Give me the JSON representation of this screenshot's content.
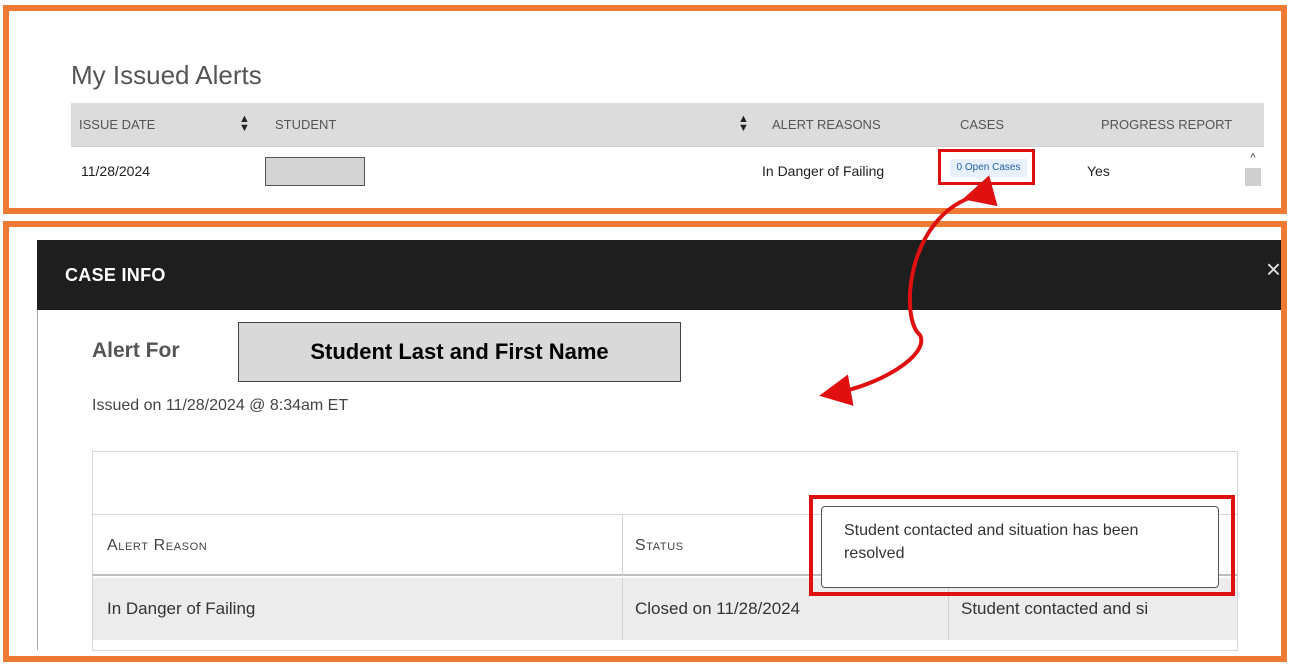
{
  "alerts": {
    "title": "My Issued Alerts",
    "columns": [
      "ISSUE DATE",
      "STUDENT",
      "ALERT REASONS",
      "CASES",
      "PROGRESS REPORT"
    ],
    "row": {
      "issue_date": "11/28/2024",
      "alert_reason": "In Danger of Failing",
      "cases_link": "0 Open Cases",
      "progress_report": "Yes"
    }
  },
  "modal": {
    "title": "CASE INFO",
    "close_icon": "×",
    "alert_for_label": "Alert For",
    "student_name": "Student Last and First Name",
    "issued_on": "Issued on 11/28/2024 @ 8:34am ET",
    "table": {
      "col_alert_reason": "Alert Reason",
      "col_status": "Status",
      "row": {
        "reason": "In Danger of Failing",
        "status": "Closed on 11/28/2024",
        "note": "Student contacted and si"
      }
    },
    "tooltip": "Student contacted and situation has been resolved"
  },
  "colors": {
    "frame": "#ee7a33",
    "highlight": "#e01010",
    "modal_header": "#1e1e1e",
    "link": "#1f5fa8"
  }
}
